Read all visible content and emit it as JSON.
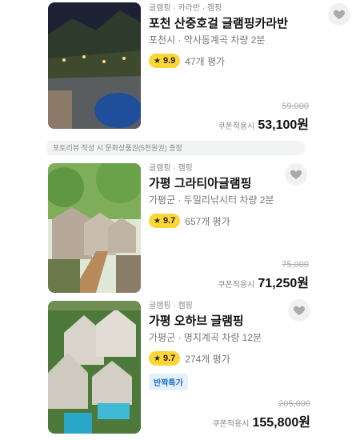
{
  "listings": [
    {
      "category": "글램핑 · 카라반 · 캠핑",
      "title": "포천 산중호걸 글램핑카라반",
      "location": "포천시 · 약사동계곡 차량 2분",
      "rating": "9.9",
      "reviews": "47개 평가",
      "original_price": "59,000",
      "coupon_label": "쿠폰적용시",
      "final_price": "53,100원",
      "favorite_icon": "heart-icon"
    },
    {
      "category": "글램핑 · 캠핑",
      "title": "가평 그라티아글램핑",
      "location": "가평군 · 두밀리낚시터 차량 2분",
      "rating": "9.7",
      "reviews": "657개 평가",
      "original_price": "75,000",
      "coupon_label": "쿠폰적용시",
      "final_price": "71,250원",
      "favorite_icon": "heart-icon"
    },
    {
      "category": "글램핑 · 캠핑",
      "title": "가평 오하브 글램핑",
      "location": "가평군 · 명지계곡 차량 12분",
      "rating": "9.7",
      "reviews": "274개 평가",
      "promo": "반짝특가",
      "original_price": "205,000",
      "coupon_label": "쿠폰적용시",
      "final_price": "155,800원",
      "favorite_icon": "heart-icon"
    }
  ],
  "notice": "포토리뷰 작성 시 문화상품권(5천원권) 증정",
  "colors": {
    "rating_badge": "#fdd535",
    "promo_text": "#1e6fd0",
    "promo_bg": "#e6f0fb"
  }
}
